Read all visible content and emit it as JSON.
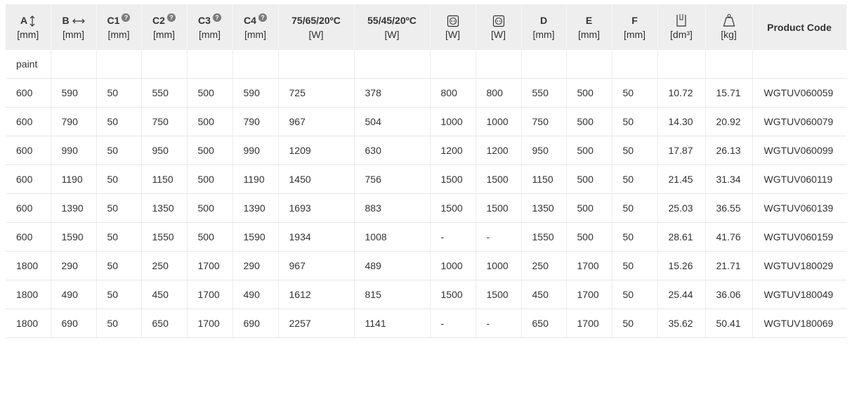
{
  "header": {
    "cols": [
      {
        "label": "A",
        "unit": "[mm]",
        "icon": "vertical-arrow-icon"
      },
      {
        "label": "B",
        "unit": "[mm]",
        "icon": "horizontal-arrow-icon"
      },
      {
        "label": "C1",
        "unit": "[mm]",
        "icon": "help-icon"
      },
      {
        "label": "C2",
        "unit": "[mm]",
        "icon": "help-icon"
      },
      {
        "label": "C3",
        "unit": "[mm]",
        "icon": "help-icon"
      },
      {
        "label": "C4",
        "unit": "[mm]",
        "icon": "help-icon"
      },
      {
        "label": "75/65/20ºC",
        "unit": "[W]"
      },
      {
        "label": "55/45/20ºC",
        "unit": "[W]"
      },
      {
        "label": "",
        "unit": "[W]",
        "icon": "socket-icon"
      },
      {
        "label": "",
        "unit": "[W]",
        "icon": "socket-icon"
      },
      {
        "label": "D",
        "unit": "[mm]"
      },
      {
        "label": "E",
        "unit": "[mm]"
      },
      {
        "label": "F",
        "unit": "[mm]"
      },
      {
        "label": "",
        "unit": "[dm³]",
        "icon": "volume-icon"
      },
      {
        "label": "",
        "unit": "[kg]",
        "icon": "weight-icon"
      },
      {
        "label": "Product Code",
        "unit": ""
      }
    ],
    "help_glyph": "?"
  },
  "group_label": "paint",
  "rows": [
    [
      "600",
      "590",
      "50",
      "550",
      "500",
      "590",
      "725",
      "378",
      "800",
      "800",
      "550",
      "500",
      "50",
      "10.72",
      "15.71",
      "WGTUV060059"
    ],
    [
      "600",
      "790",
      "50",
      "750",
      "500",
      "790",
      "967",
      "504",
      "1000",
      "1000",
      "750",
      "500",
      "50",
      "14.30",
      "20.92",
      "WGTUV060079"
    ],
    [
      "600",
      "990",
      "50",
      "950",
      "500",
      "990",
      "1209",
      "630",
      "1200",
      "1200",
      "950",
      "500",
      "50",
      "17.87",
      "26.13",
      "WGTUV060099"
    ],
    [
      "600",
      "1190",
      "50",
      "1150",
      "500",
      "1190",
      "1450",
      "756",
      "1500",
      "1500",
      "1150",
      "500",
      "50",
      "21.45",
      "31.34",
      "WGTUV060119"
    ],
    [
      "600",
      "1390",
      "50",
      "1350",
      "500",
      "1390",
      "1693",
      "883",
      "1500",
      "1500",
      "1350",
      "500",
      "50",
      "25.03",
      "36.55",
      "WGTUV060139"
    ],
    [
      "600",
      "1590",
      "50",
      "1550",
      "500",
      "1590",
      "1934",
      "1008",
      "-",
      "-",
      "1550",
      "500",
      "50",
      "28.61",
      "41.76",
      "WGTUV060159"
    ],
    [
      "1800",
      "290",
      "50",
      "250",
      "1700",
      "290",
      "967",
      "489",
      "1000",
      "1000",
      "250",
      "1700",
      "50",
      "15.26",
      "21.71",
      "WGTUV180029"
    ],
    [
      "1800",
      "490",
      "50",
      "450",
      "1700",
      "490",
      "1612",
      "815",
      "1500",
      "1500",
      "450",
      "1700",
      "50",
      "25.44",
      "36.06",
      "WGTUV180049"
    ],
    [
      "1800",
      "690",
      "50",
      "650",
      "1700",
      "690",
      "2257",
      "1141",
      "-",
      "-",
      "650",
      "1700",
      "50",
      "35.62",
      "50.41",
      "WGTUV180069"
    ]
  ]
}
